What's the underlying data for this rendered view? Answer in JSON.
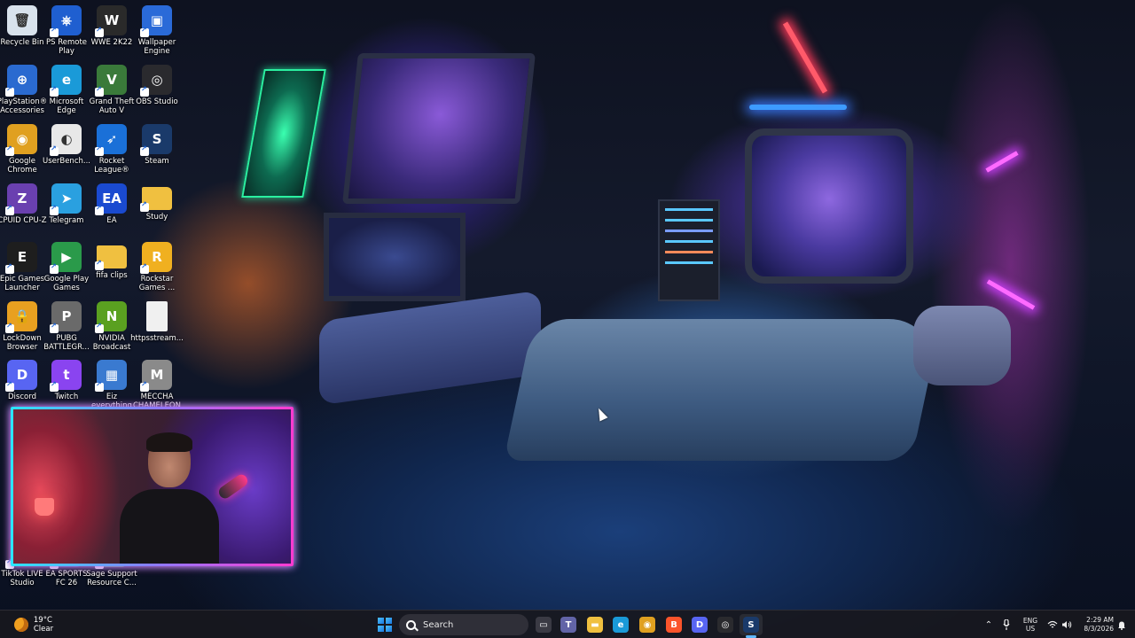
{
  "desktop": {
    "icons": [
      {
        "id": "recycle-bin",
        "label": "Recycle Bin",
        "icon": "recycle-bin-icon",
        "color": "#d8e2ec"
      },
      {
        "id": "ps-remote-play",
        "label": "PS Remote\nPlay",
        "icon": "ps-remote-play-icon",
        "color": "#1f5fd0"
      },
      {
        "id": "wwe-2k22",
        "label": "WWE 2K22",
        "icon": "wwe-icon",
        "color": "#2a2a2a"
      },
      {
        "id": "wallpaper-engine",
        "label": "Wallpaper\nEngine",
        "icon": "wallpaper-engine-icon",
        "color": "#2a6ad8"
      },
      {
        "id": "playstation-accessories",
        "label": "PlayStation®\nAccessories",
        "icon": "playstation-icon",
        "color": "#2a6ad0"
      },
      {
        "id": "microsoft-edge",
        "label": "Microsoft\nEdge",
        "icon": "edge-icon",
        "color": "#1a9ad8"
      },
      {
        "id": "gta-v",
        "label": "Grand Theft\nAuto V",
        "icon": "gta-icon",
        "color": "#3a7a3a"
      },
      {
        "id": "obs-studio",
        "label": "OBS Studio",
        "icon": "obs-icon",
        "color": "#2a2a2e"
      },
      {
        "id": "google-chrome",
        "label": "Google\nChrome",
        "icon": "chrome-icon",
        "color": "#e0a020"
      },
      {
        "id": "userbenchmark",
        "label": "UserBench...",
        "icon": "userbenchmark-icon",
        "color": "#e8e8e8"
      },
      {
        "id": "rocket-league",
        "label": "Rocket\nLeague®",
        "icon": "rocket-league-icon",
        "color": "#1a70d8"
      },
      {
        "id": "steam",
        "label": "Steam",
        "icon": "steam-icon",
        "color": "#1a3a6a"
      },
      {
        "id": "cpuid-cpu-z",
        "label": "CPUID CPU-Z",
        "icon": "cpu-z-icon",
        "color": "#6a40b0"
      },
      {
        "id": "telegram",
        "label": "Telegram",
        "icon": "telegram-icon",
        "color": "#2aa0e0"
      },
      {
        "id": "ea",
        "label": "EA",
        "icon": "ea-icon",
        "color": "#1a4ad0"
      },
      {
        "id": "study",
        "label": "Study",
        "icon": "folder-icon",
        "color": "#f0c040"
      },
      {
        "id": "epic-games",
        "label": "Epic Games\nLauncher",
        "icon": "epic-games-icon",
        "color": "#1e1e1e"
      },
      {
        "id": "google-play-games",
        "label": "Google Play\nGames",
        "icon": "google-play-games-icon",
        "color": "#2a9a4a"
      },
      {
        "id": "fifa-clips",
        "label": "fifa clips",
        "icon": "folder-icon",
        "color": "#f0c040"
      },
      {
        "id": "rockstar-games",
        "label": "Rockstar\nGames ...",
        "icon": "rockstar-icon",
        "color": "#f0b020"
      },
      {
        "id": "lockdown-browser",
        "label": "LockDown\nBrowser",
        "icon": "lockdown-browser-icon",
        "color": "#e8a020"
      },
      {
        "id": "pubg",
        "label": "PUBG\nBATTLEGR...",
        "icon": "pubg-icon",
        "color": "#6a6a6a"
      },
      {
        "id": "nvidia-broadcast",
        "label": "NVIDIA\nBroadcast",
        "icon": "nvidia-icon",
        "color": "#5aa020"
      },
      {
        "id": "https-stream",
        "label": "httpsstream...",
        "icon": "file-icon",
        "color": "#f0f0f0"
      },
      {
        "id": "discord",
        "label": "Discord",
        "icon": "discord-icon",
        "color": "#5865f2"
      },
      {
        "id": "twitch",
        "label": "Twitch",
        "icon": "twitch-icon",
        "color": "#8a44f0"
      },
      {
        "id": "eiz-everything",
        "label": "Eiz\neverything",
        "icon": "image-icon",
        "color": "#3a7ad0"
      },
      {
        "id": "meccha-chameleon",
        "label": "MECCHA\nCHAMELEON",
        "icon": "meccha-icon",
        "color": "#8a8a8a"
      },
      {
        "id": "tiktok-live-studio",
        "label": "TikTok LIVE\nStudio",
        "icon": "tiktok-icon",
        "color": "#111111"
      },
      {
        "id": "ea-sports-fc-26",
        "label": "EA SPORTS\nFC 26",
        "icon": "ea-sports-icon",
        "color": "#1a3a6a"
      },
      {
        "id": "sage-support",
        "label": "Sage Support\nResource C...",
        "icon": "sage-icon",
        "color": "#2aa040"
      }
    ]
  },
  "taskbar": {
    "weather": {
      "temp": "19°C",
      "condition": "Clear"
    },
    "search_label": "Search",
    "apps": [
      {
        "name": "task-view",
        "icon": "task-view-icon",
        "glyph": "▭",
        "color": "#3a3a44"
      },
      {
        "name": "teams",
        "icon": "teams-icon",
        "glyph": "T",
        "color": "#6264a7"
      },
      {
        "name": "file-explorer",
        "icon": "folder-icon",
        "glyph": "▬",
        "color": "#f0c040"
      },
      {
        "name": "edge",
        "icon": "edge-icon",
        "glyph": "e",
        "color": "#1a9ad8"
      },
      {
        "name": "chrome",
        "icon": "chrome-icon",
        "glyph": "◉",
        "color": "#e0a020"
      },
      {
        "name": "brave",
        "icon": "brave-icon",
        "glyph": "B",
        "color": "#fb542b"
      },
      {
        "name": "discord",
        "icon": "discord-icon",
        "glyph": "D",
        "color": "#5865f2"
      },
      {
        "name": "obs",
        "icon": "obs-icon",
        "glyph": "◎",
        "color": "#2a2a2e"
      },
      {
        "name": "steam",
        "icon": "steam-icon",
        "glyph": "S",
        "color": "#1a3a6a"
      }
    ],
    "tray": {
      "language": "ENG",
      "region": "US",
      "time": "2:29 AM",
      "date": "8/3/2026"
    }
  }
}
